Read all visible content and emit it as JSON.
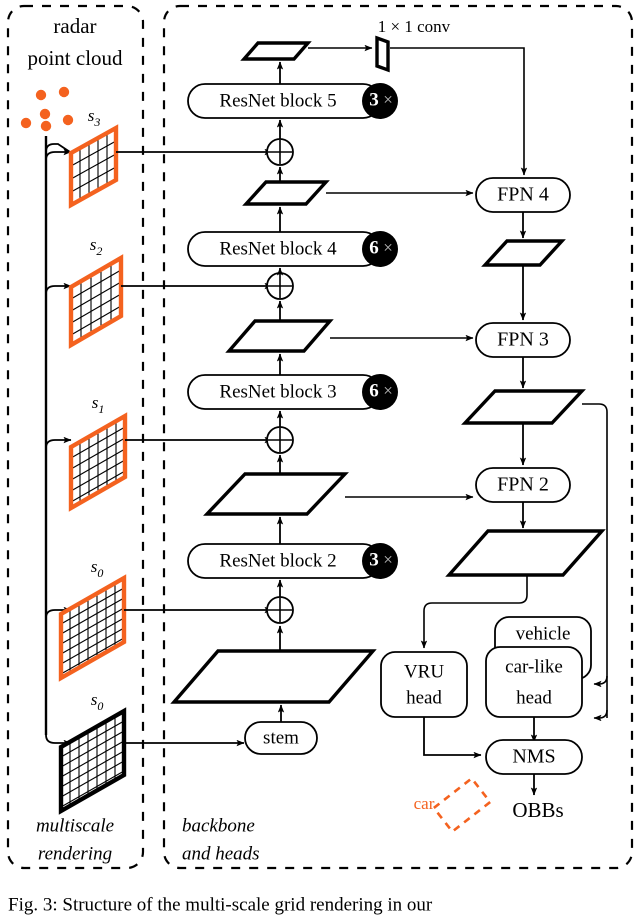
{
  "figure": {
    "caption": "Fig. 3: Structure of the multi-scale grid rendering in our",
    "accent_color": "#F4621F",
    "line_color": "#000000"
  },
  "left_panel": {
    "name": "multiscale rendering",
    "title_line1": "radar",
    "title_line2": "point cloud",
    "footer_line1": "multiscale",
    "footer_line2": "rendering",
    "point_count": 6,
    "grids": [
      {
        "label": "s",
        "sub": "3",
        "color": "#F4621F",
        "cells": 4
      },
      {
        "label": "s",
        "sub": "2",
        "color": "#F4621F",
        "cells": 5
      },
      {
        "label": "s",
        "sub": "1",
        "color": "#F4621F",
        "cells": 6
      },
      {
        "label": "s",
        "sub": "0",
        "color": "#F4621F",
        "cells": 7
      },
      {
        "label": "s",
        "sub": "0",
        "color": "#000000",
        "cells": 8
      }
    ]
  },
  "right_panel": {
    "name_line1": "backbone",
    "name_line2": "and heads",
    "conv_label": "1 × 1  conv",
    "resnet_blocks": [
      {
        "label": "ResNet block 5",
        "repeat": "3",
        "times": "×"
      },
      {
        "label": "ResNet block 4",
        "repeat": "6",
        "times": "×"
      },
      {
        "label": "ResNet block 3",
        "repeat": "6",
        "times": "×"
      },
      {
        "label": "ResNet block 2",
        "repeat": "3",
        "times": "×"
      }
    ],
    "stem_label": "stem",
    "fpn_nodes": [
      {
        "label": "FPN 4"
      },
      {
        "label": "FPN 3"
      },
      {
        "label": "FPN 2"
      }
    ],
    "heads": [
      {
        "line1": "VRU",
        "line2": "head"
      },
      {
        "line1": "vehicle",
        "line2": ""
      },
      {
        "line1": "car-like",
        "line2": "head"
      }
    ],
    "nms_label": "NMS",
    "output_label": "OBBs",
    "obb_example_label": "car"
  }
}
